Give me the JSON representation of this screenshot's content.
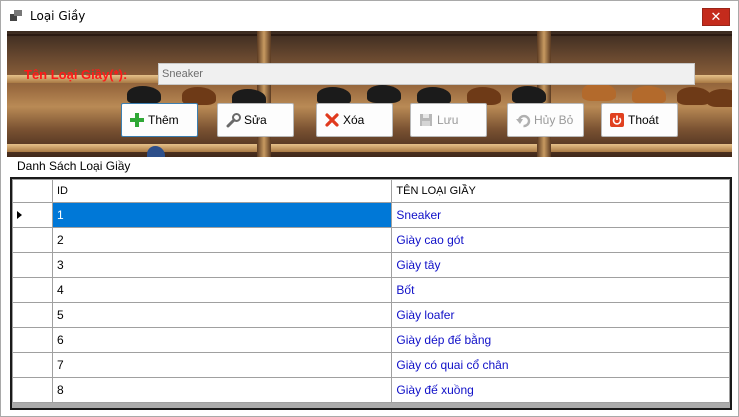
{
  "window": {
    "title": "Loại Giầy",
    "close_symbol": "✕"
  },
  "form": {
    "name_label": "Tên Loại Giầy(*):",
    "name_value": "Sneaker"
  },
  "toolbar": {
    "add_label": "Thêm",
    "edit_label": "Sửa",
    "delete_label": "Xóa",
    "save_label": "Lưu",
    "cancel_label": "Hủy Bỏ",
    "exit_label": "Thoát"
  },
  "list": {
    "group_label": "Danh Sách Loại Giầy",
    "columns": [
      "ID",
      "TÊN LOẠI GIẦY"
    ],
    "rows": [
      {
        "id": "1",
        "name": "Sneaker"
      },
      {
        "id": "2",
        "name": "Giày cao gót"
      },
      {
        "id": "3",
        "name": "Giày tây"
      },
      {
        "id": "4",
        "name": "Bốt"
      },
      {
        "id": "5",
        "name": "Giày loafer"
      },
      {
        "id": "6",
        "name": "Giày dép đế bằng"
      },
      {
        "id": "7",
        "name": "Giày có quai cổ chân"
      },
      {
        "id": "8",
        "name": "Giày đế xuồng"
      }
    ],
    "selected_index": 0
  },
  "colors": {
    "label_red": "#ff1a1a",
    "selection_blue": "#0078d7",
    "link_blue": "#1010c8",
    "close_red": "#c42b1c"
  },
  "icons": {
    "add": "plus-icon",
    "edit": "wrench-icon",
    "delete": "x-icon",
    "save": "floppy-disk-icon",
    "cancel": "undo-icon",
    "exit": "power-icon"
  }
}
